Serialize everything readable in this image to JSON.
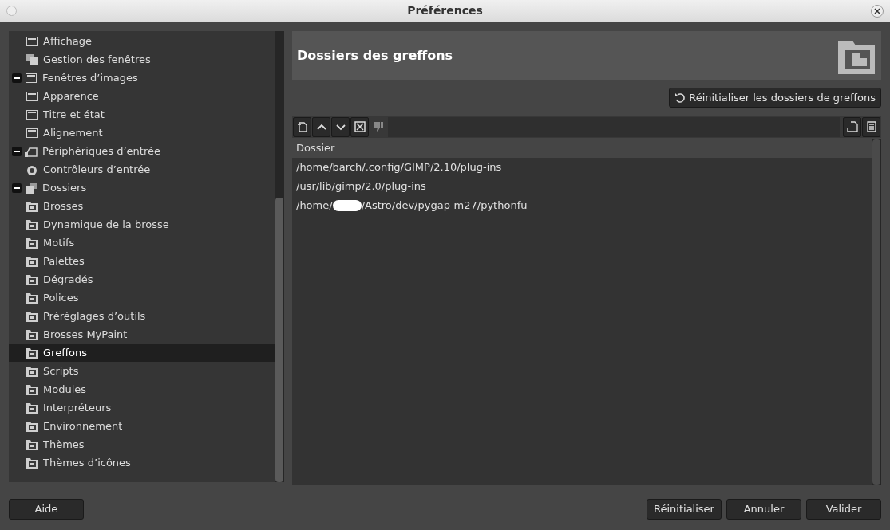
{
  "window": {
    "title": "Préférences"
  },
  "sidebar": {
    "items": [
      {
        "children": [
          {
            "label": "Affichage",
            "kind": "window",
            "selected": false
          },
          {
            "label": "Gestion des fenêtres",
            "kind": "windows",
            "selected": false
          }
        ]
      },
      {
        "label": "Fenêtres d’images",
        "kind": "window",
        "expanded": true,
        "selected": false,
        "children": [
          {
            "label": "Apparence",
            "kind": "window",
            "selected": false
          },
          {
            "label": "Titre et état",
            "kind": "window",
            "selected": false
          },
          {
            "label": "Alignement",
            "kind": "window",
            "selected": false
          }
        ]
      },
      {
        "label": "Périphériques d’entrée",
        "kind": "device",
        "expanded": true,
        "selected": false,
        "children": [
          {
            "label": "Contrôleurs d’entrée",
            "kind": "dial",
            "selected": false
          }
        ]
      },
      {
        "label": "Dossiers",
        "kind": "folders",
        "expanded": true,
        "selected": false,
        "children": [
          {
            "label": "Brosses",
            "kind": "folder",
            "selected": false
          },
          {
            "label": "Dynamique de la brosse",
            "kind": "folder",
            "selected": false
          },
          {
            "label": "Motifs",
            "kind": "folder",
            "selected": false
          },
          {
            "label": "Palettes",
            "kind": "folder",
            "selected": false
          },
          {
            "label": "Dégradés",
            "kind": "folder",
            "selected": false
          },
          {
            "label": "Polices",
            "kind": "folder",
            "selected": false
          },
          {
            "label": "Préréglages d’outils",
            "kind": "folder",
            "selected": false
          },
          {
            "label": "Brosses MyPaint",
            "kind": "folder",
            "selected": false
          },
          {
            "label": "Greffons",
            "kind": "folder",
            "selected": true
          },
          {
            "label": "Scripts",
            "kind": "folder",
            "selected": false
          },
          {
            "label": "Modules",
            "kind": "folder",
            "selected": false
          },
          {
            "label": "Interpréteurs",
            "kind": "folder",
            "selected": false
          },
          {
            "label": "Environnement",
            "kind": "folder",
            "selected": false
          },
          {
            "label": "Thèmes",
            "kind": "folder",
            "selected": false
          },
          {
            "label": "Thèmes d’icônes",
            "kind": "folder",
            "selected": false
          }
        ]
      }
    ]
  },
  "header": {
    "title": "Dossiers des greffons"
  },
  "reset_folders_button": "Réinitialiser les dossiers de greffons",
  "table": {
    "columns": [
      "Dossier"
    ],
    "rows": [
      {
        "path": "/home/barch/.config/GIMP/2.10/plug-ins",
        "redacted": false
      },
      {
        "path": "/usr/lib/gimp/2.0/plug-ins",
        "redacted": false
      },
      {
        "path": "/home/",
        "redacted": true,
        "path_end": "/Astro/dev/pygap-m27/pythonfu"
      }
    ]
  },
  "buttons": [
    {
      "label": "Aide",
      "kind": "left"
    },
    {
      "label": "Réinitialiser",
      "kind": "right"
    },
    {
      "label": "Annuler",
      "kind": "right"
    },
    {
      "label": "Valider",
      "kind": "right"
    }
  ]
}
